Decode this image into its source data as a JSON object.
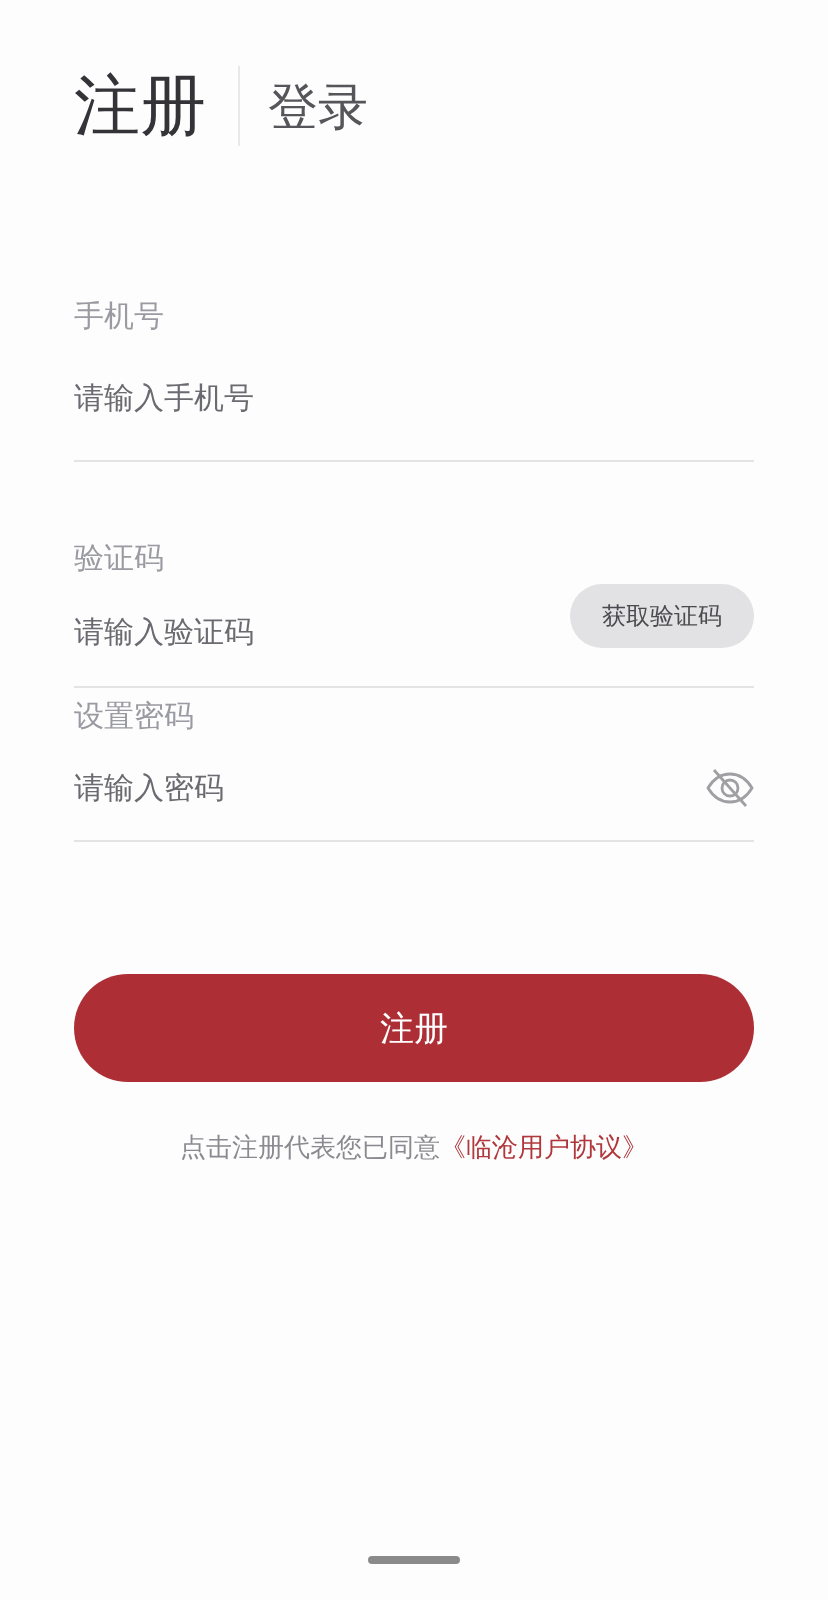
{
  "tabs": [
    {
      "label": "注册",
      "selected": true
    },
    {
      "label": "登录",
      "selected": false
    }
  ],
  "fields": [
    {
      "kind": "phone",
      "label": "手机号",
      "placeholder": "请输入手机号"
    },
    {
      "kind": "code",
      "label": "验证码",
      "placeholder": "请输入验证码",
      "action": "获取验证码"
    },
    {
      "kind": "password",
      "label": "设置密码",
      "placeholder": "请输入密码"
    }
  ],
  "submit": "注册",
  "agreement": {
    "text": "点击注册代表您已同意",
    "link": "《临沧用户协议》"
  }
}
